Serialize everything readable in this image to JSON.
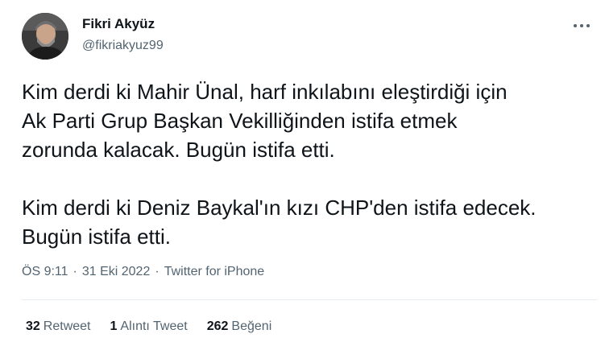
{
  "author": {
    "name": "Fikri Akyüz",
    "handle": "@fikriakyuz99"
  },
  "tweet": {
    "text": "Kim derdi ki Mahir Ünal, harf inkılabını eleştirdiği için\nAk Parti Grup Başkan Vekilliğinden istifa etmek\nzorunda kalacak. Bugün istifa etti.\n\nKim derdi ki Deniz Baykal'ın kızı CHP'den istifa edecek.\nBugün istifa etti."
  },
  "meta": {
    "time": "ÖS 9:11",
    "separator": "·",
    "date": "31 Eki 2022",
    "source": "Twitter for iPhone"
  },
  "stats": {
    "retweets_count": "32",
    "retweets_label": "Retweet",
    "quotes_count": "1",
    "quotes_label": "Alıntı Tweet",
    "likes_count": "262",
    "likes_label": "Beğeni"
  },
  "icons": {
    "more": "more-horizontal-icon"
  }
}
